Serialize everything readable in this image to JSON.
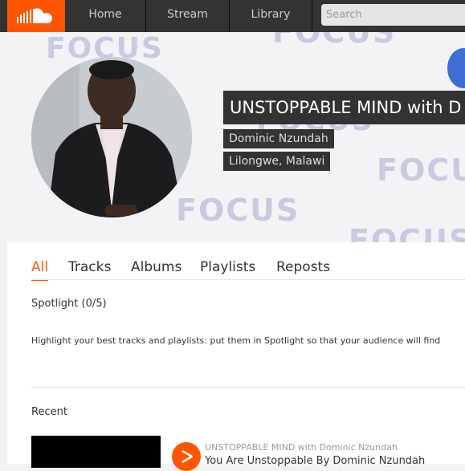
{
  "nav": {
    "logo_icon": "soundcloud-logo-icon",
    "home": "Home",
    "stream": "Stream",
    "library": "Library",
    "search_placeholder": "Search"
  },
  "profile": {
    "title": "UNSTOPPABLE MIND with D",
    "name": "Dominic Nzundah",
    "location": "Lilongwe, Malawi",
    "banner_watermark": "FOCUS"
  },
  "tabs": [
    "All",
    "Tracks",
    "Albums",
    "Playlists",
    "Reposts"
  ],
  "spotlight": {
    "heading": "Spotlight (0/5)",
    "hint": "Highlight your best tracks and playlists: put them in Spotlight so that your audience will find"
  },
  "recent": {
    "heading": "Recent",
    "track_user": "UNSTOPPABLE MIND with Dominic Nzundah",
    "track_title": "You Are Unstoppable By Dominic Nzundah"
  },
  "colors": {
    "accent": "#ff5500",
    "topbar": "#333333"
  }
}
